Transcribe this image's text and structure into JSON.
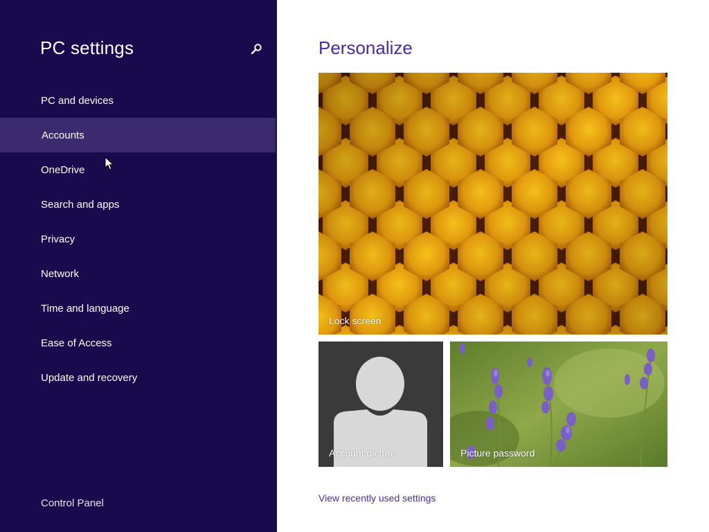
{
  "sidebar": {
    "title": "PC settings",
    "search_icon": "search-icon",
    "items": [
      {
        "label": "PC and devices"
      },
      {
        "label": "Accounts",
        "selected": true
      },
      {
        "label": "OneDrive"
      },
      {
        "label": "Search and apps"
      },
      {
        "label": "Privacy"
      },
      {
        "label": "Network"
      },
      {
        "label": "Time and language"
      },
      {
        "label": "Ease of Access"
      },
      {
        "label": "Update and recovery"
      }
    ],
    "footer_link": "Control Panel"
  },
  "main": {
    "title": "Personalize",
    "tiles": {
      "lock_screen": "Lock screen",
      "account_picture": "Account picture",
      "picture_password": "Picture password"
    },
    "recent_link": "View recently used settings"
  },
  "colors": {
    "sidebar_bg": "#180a4c",
    "selected_bg": "#3b2a6e",
    "accent": "#4a2c9e"
  }
}
